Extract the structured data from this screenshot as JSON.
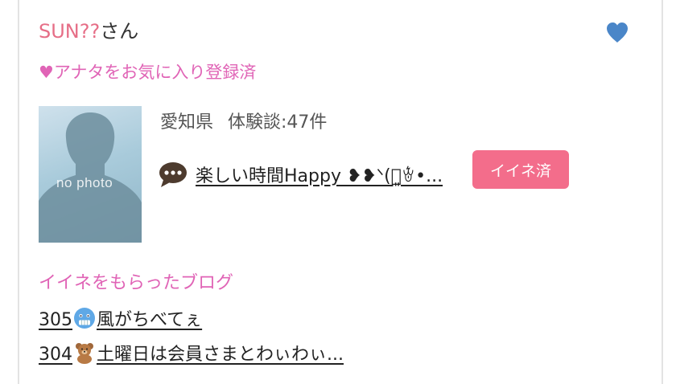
{
  "profile": {
    "nickname": "SUN??",
    "suffix": "さん",
    "favorite_status": "♥アナタをお気に入り登録済",
    "location": "愛知県",
    "experience_count": "体験談:47件",
    "avatar_placeholder": "no photo"
  },
  "diary": {
    "icon": "speech-bubble-icon",
    "title": "楽しい時間Happy ❥❥ᐠ(꒪͈ꄃ•...",
    "iine_button": "イイネ済"
  },
  "blogs": {
    "heading": "イイネをもらったブログ",
    "items": [
      {
        "prefix": "305",
        "emoji": "cold-face-icon",
        "text": "風がちべてぇ"
      },
      {
        "prefix": "304",
        "emoji": "teddy-bear-icon",
        "text": "土曜日は会員さまとわぃわぃ..."
      }
    ]
  },
  "colors": {
    "nickname": "#e66e87",
    "accent_pink": "#e064b6",
    "button": "#f36d8b",
    "heart": "#4a86c8"
  }
}
